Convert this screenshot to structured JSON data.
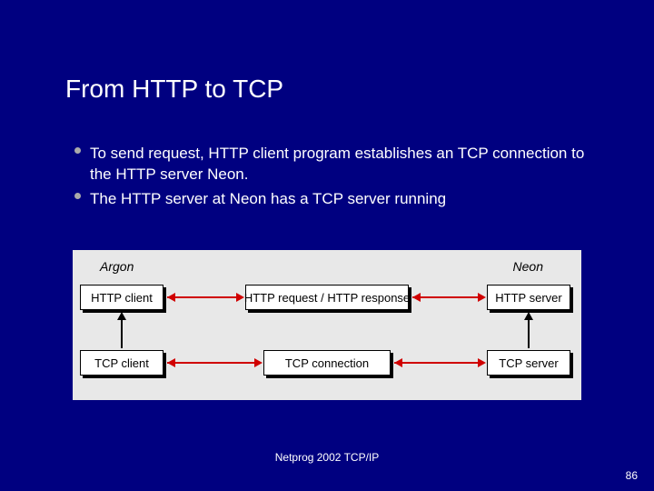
{
  "title": "From HTTP to TCP",
  "bullets": [
    "To send request, HTTP client program establishes an TCP connection to the HTTP server Neon.",
    "The HTTP server at Neon has a TCP server running"
  ],
  "diagram": {
    "hosts": {
      "left": "Argon",
      "right": "Neon"
    },
    "boxes": {
      "http_client": "HTTP client",
      "http_mid": "HTTP request / HTTP response",
      "http_server": "HTTP server",
      "tcp_client": "TCP client",
      "tcp_mid": "TCP connection",
      "tcp_server": "TCP server"
    }
  },
  "footer": "Netprog 2002  TCP/IP",
  "page": "86"
}
